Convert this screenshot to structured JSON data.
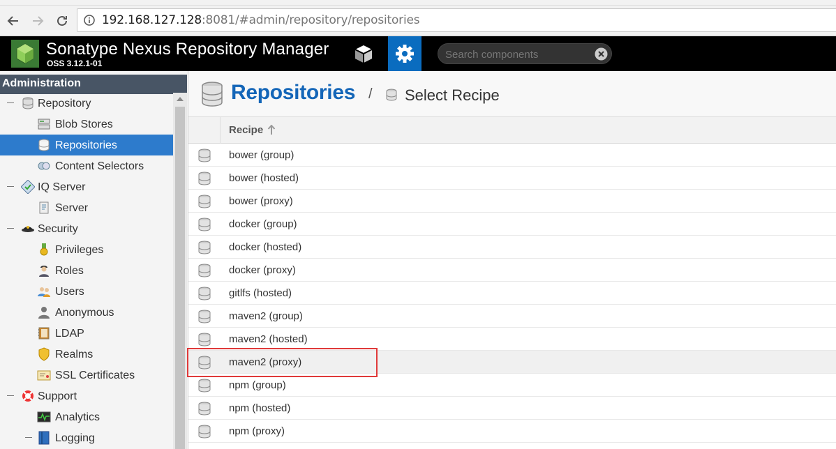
{
  "browser": {
    "url_host": "192.168.127.128",
    "url_rest": ":8081/#admin/repository/repositories"
  },
  "header": {
    "title": "Sonatype Nexus Repository Manager",
    "version": "OSS 3.12.1-01",
    "search_placeholder": "Search components"
  },
  "sidebar": {
    "title": "Administration",
    "items": [
      {
        "label": "Repository"
      },
      {
        "label": "Blob Stores"
      },
      {
        "label": "Repositories"
      },
      {
        "label": "Content Selectors"
      },
      {
        "label": "IQ Server"
      },
      {
        "label": "Server"
      },
      {
        "label": "Security"
      },
      {
        "label": "Privileges"
      },
      {
        "label": "Roles"
      },
      {
        "label": "Users"
      },
      {
        "label": "Anonymous"
      },
      {
        "label": "LDAP"
      },
      {
        "label": "Realms"
      },
      {
        "label": "SSL Certificates"
      },
      {
        "label": "Support"
      },
      {
        "label": "Analytics"
      },
      {
        "label": "Logging"
      }
    ]
  },
  "main": {
    "title": "Repositories",
    "breadcrumb_sep": "/",
    "breadcrumb": "Select Recipe",
    "column_recipe": "Recipe",
    "recipes": [
      "bower (group)",
      "bower (hosted)",
      "bower (proxy)",
      "docker (group)",
      "docker (hosted)",
      "docker (proxy)",
      "gitlfs (hosted)",
      "maven2 (group)",
      "maven2 (hosted)",
      "maven2 (proxy)",
      "npm (group)",
      "npm (hosted)",
      "npm (proxy)"
    ]
  },
  "colors": {
    "accent": "#0a6cbf",
    "selected": "#2d7bcc",
    "sidebar_header": "#485565",
    "highlight_border": "#e03a3a"
  }
}
